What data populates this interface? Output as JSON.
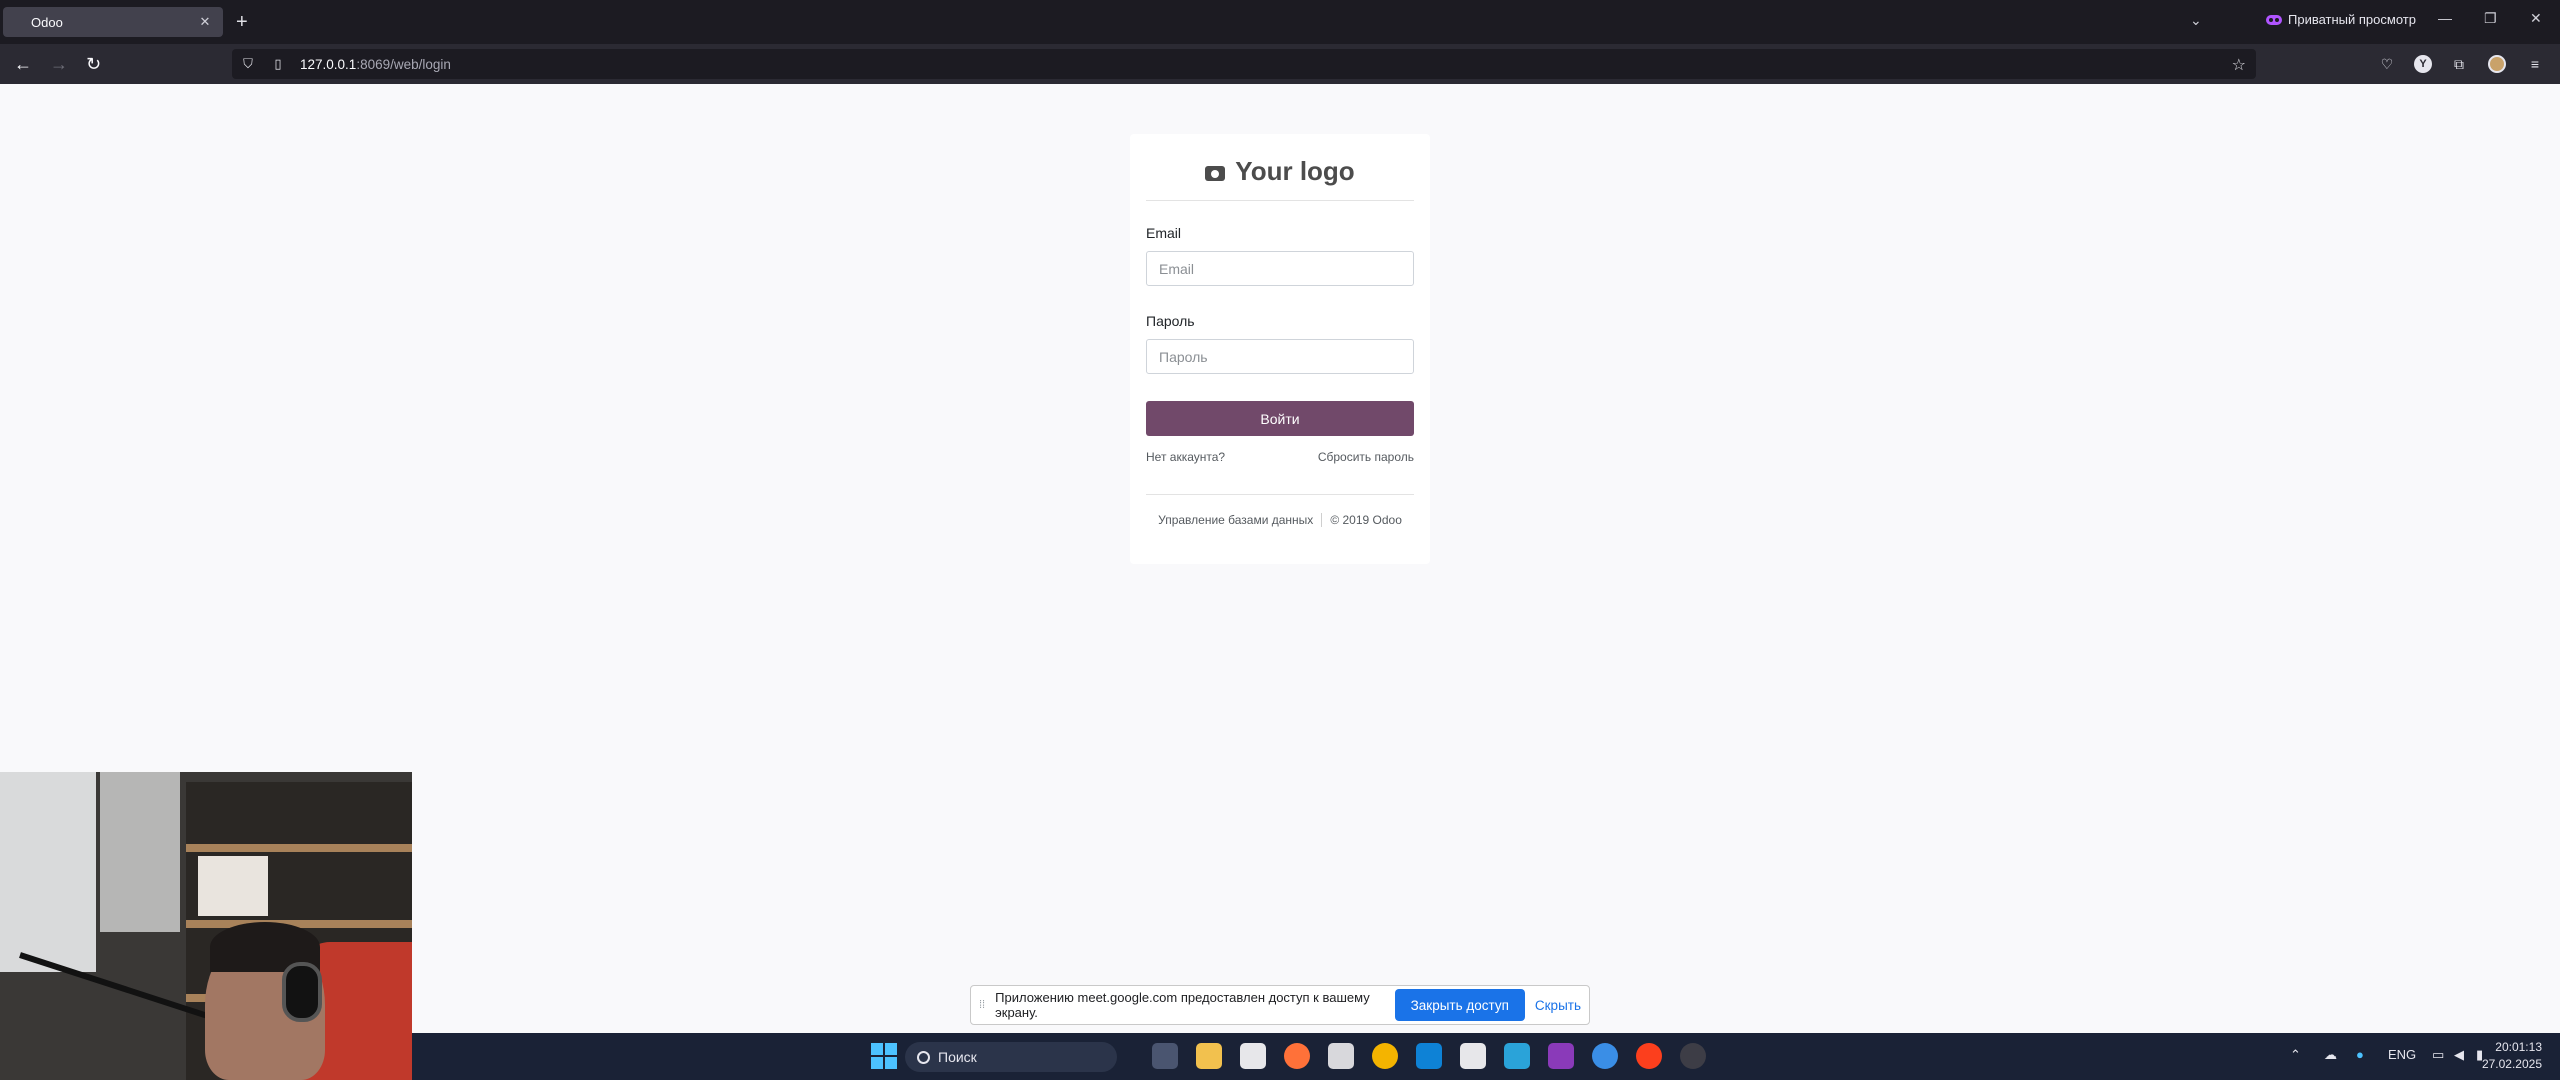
{
  "browser": {
    "tab_title": "Odoo",
    "tab_close": "✕",
    "new_tab": "+",
    "private_label": "Приватный просмотр",
    "url_host": "127.0.0.1",
    "url_rest": ":8069/web/login"
  },
  "login": {
    "logo_text": "Your logo",
    "email_label": "Email",
    "email_placeholder": "Email",
    "password_label": "Пароль",
    "password_placeholder": "Пароль",
    "submit_label": "Войти",
    "no_account": "Нет аккаунта?",
    "reset_password": "Сбросить пароль",
    "manage_db": "Управление базами данных",
    "copyright": "© 2019 Odoo"
  },
  "share_notice": {
    "message": "Приложению meet.google.com предоставлен доступ к вашему экрану.",
    "stop_label": "Закрыть доступ",
    "hide_label": "Скрыть"
  },
  "taskbar": {
    "search_label": "Поиск",
    "language": "ENG",
    "time": "20:01:13",
    "date": "27.02.2025"
  },
  "colors": {
    "odoo_primary": "#71496a",
    "browser_bg": "#1c1b22",
    "share_button": "#1a73e8"
  }
}
